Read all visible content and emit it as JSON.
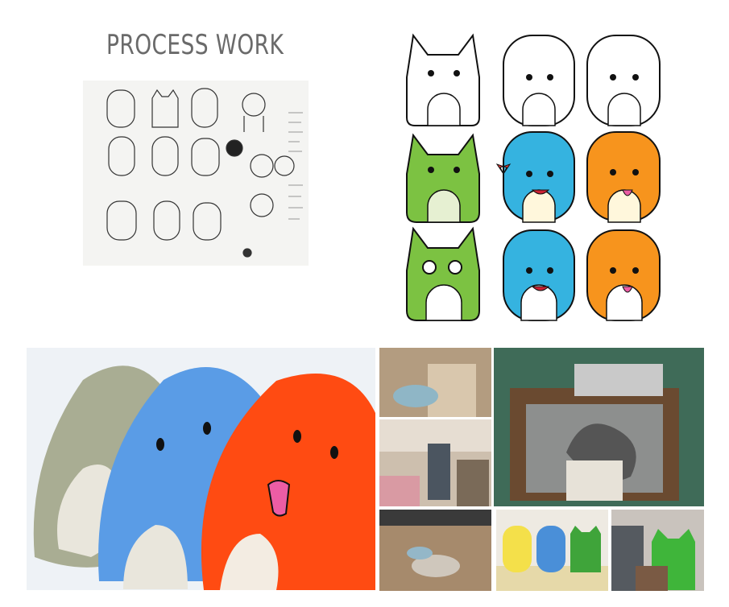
{
  "header": {
    "title": "PROCESS WORK"
  },
  "images": {
    "sketch": {
      "icon": "sketch-sheet-icon"
    },
    "characters": {
      "icon": "monster-grid-icon"
    },
    "plush": {
      "icon": "plush-toys-icon"
    },
    "photos": [
      "workshop-photo-1",
      "workshop-photo-2",
      "vacuum-form-photo",
      "workshop-photo-3",
      "figurines-photo",
      "holding-figure-photo"
    ]
  },
  "colors": {
    "green": "#7cc242",
    "blue": "#35b3e0",
    "orange": "#f7941d",
    "plush_gray": "#a9ad93",
    "plush_blue": "#5a9ce6",
    "plush_orange": "#ff4b12"
  }
}
